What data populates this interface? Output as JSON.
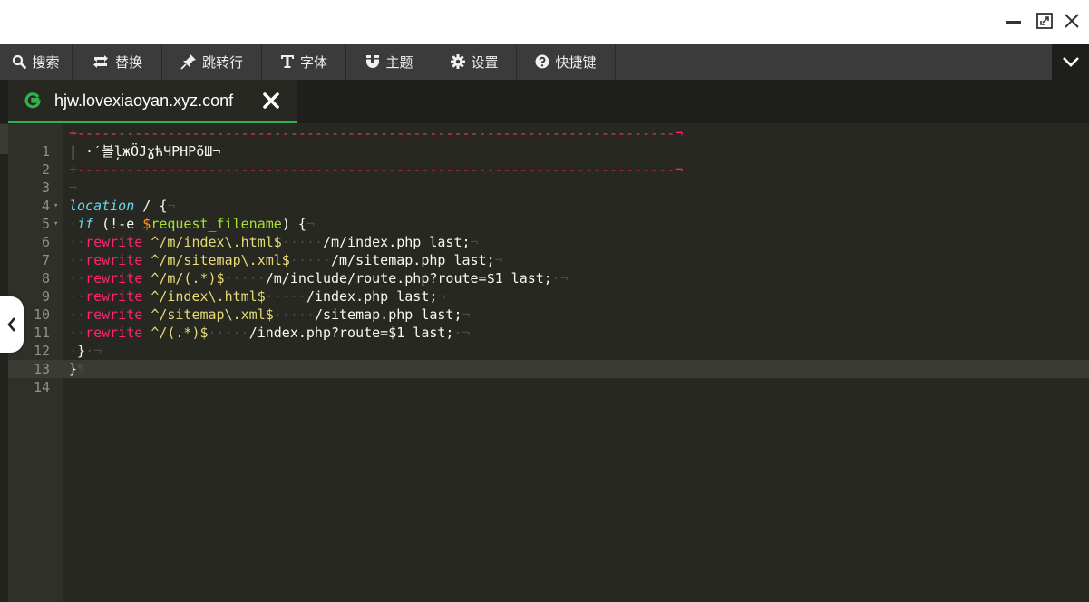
{
  "window_controls": {
    "minimize_icon": "minimize-icon",
    "maximize_icon": "maximize-icon",
    "close_icon": "close-icon"
  },
  "toolbar": {
    "items": [
      {
        "label": "搜索",
        "icon": "search-icon"
      },
      {
        "label": "替换",
        "icon": "replace-icon"
      },
      {
        "label": "跳转行",
        "icon": "pin-icon"
      },
      {
        "label": "字体",
        "icon": "font-icon"
      },
      {
        "label": "主题",
        "icon": "magnet-icon"
      },
      {
        "label": "设置",
        "icon": "gear-icon"
      },
      {
        "label": "快捷键",
        "icon": "help-icon"
      }
    ],
    "collapse_icon": "chevron-down-icon"
  },
  "tab": {
    "title": "hjw.lovexiaoyan.xyz.conf",
    "icon": "file-g-icon",
    "close_icon": "close-x-icon",
    "accent_color": "#31b14e"
  },
  "editor": {
    "theme_colors": {
      "background": "#272822",
      "keyword": "#66d9ef",
      "string": "#e6db74",
      "directive": "#f92672",
      "variable": "#a6e22e"
    },
    "lines": [
      {
        "num": "1",
        "fold": "",
        "text": "+-------------------------------------------------------------------------¬"
      },
      {
        "num": "2",
        "fold": "",
        "text": "| ·ˊ볼ļжÖЈɣћЧPHPõШ¬"
      },
      {
        "num": "3",
        "fold": "",
        "text": "+-------------------------------------------------------------------------¬"
      },
      {
        "num": "4",
        "fold": "",
        "text": "¬"
      },
      {
        "num": "5",
        "fold": "▾",
        "text": "location / {"
      },
      {
        "num": "6",
        "fold": "▾",
        "text": " if (!-e $request_filename) {"
      },
      {
        "num": "7",
        "fold": "",
        "text": "  rewrite ^/m/index\\.html$     /m/index.php last;"
      },
      {
        "num": "8",
        "fold": "",
        "text": "  rewrite ^/m/sitemap\\.xml$     /m/sitemap.php last;"
      },
      {
        "num": "9",
        "fold": "",
        "text": "  rewrite ^/m/(.*)$     /m/include/route.php?route=$1 last;"
      },
      {
        "num": "10",
        "fold": "",
        "text": "  rewrite ^/index\\.html$     /index.php last;"
      },
      {
        "num": "11",
        "fold": "",
        "text": "  rewrite ^/sitemap\\.xml$     /sitemap.php last;"
      },
      {
        "num": "12",
        "fold": "",
        "text": "  rewrite ^/(.*)$     /index.php?route=$1 last;"
      },
      {
        "num": "13",
        "fold": "",
        "text": " }"
      },
      {
        "num": "14",
        "fold": "",
        "text": "}¶"
      }
    ]
  },
  "side_handle": {
    "icon": "chevron-left-icon"
  }
}
